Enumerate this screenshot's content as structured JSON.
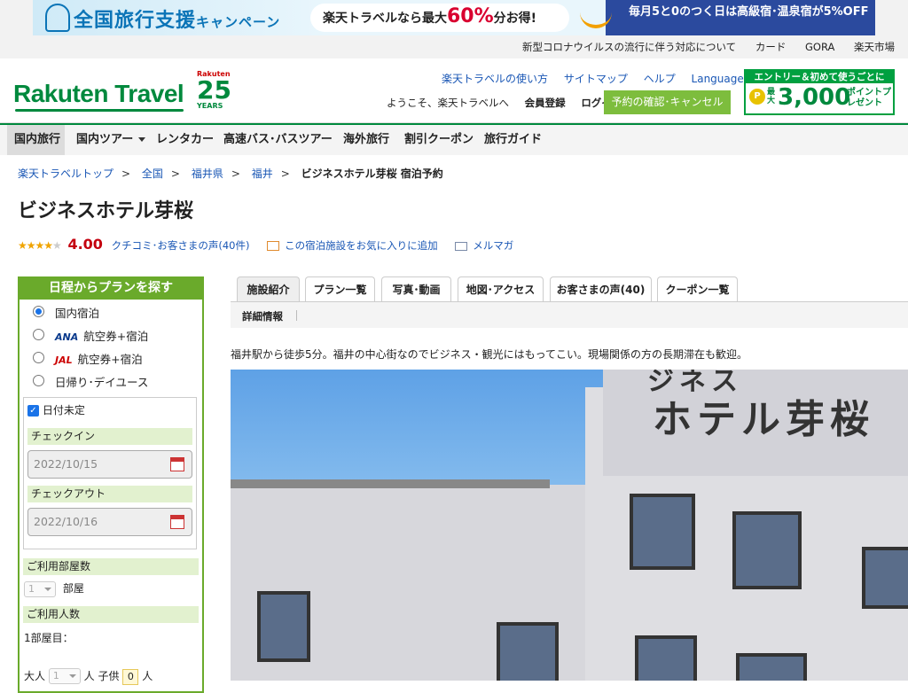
{
  "banner": {
    "title": "全国旅行支援",
    "title_suffix": "キャンペーン",
    "pill_pre": "楽天トラベルなら最大",
    "pill_num": "60%",
    "pill_post": "分お得!",
    "right_line1": "毎月5と0のつく日は高級宿･温泉宿が5%OFF"
  },
  "util_links": [
    "新型コロナウイルスの流行に伴う対応について",
    "カード",
    "GORA",
    "楽天市場"
  ],
  "header": {
    "logo": "Rakuten Travel",
    "years_brand": "Rakuten",
    "years_num": "25",
    "years_label": "YEARS",
    "links": [
      "楽天トラベルの使い方",
      "サイトマップ",
      "ヘルプ"
    ],
    "languages": "Languages",
    "welcome": "ようこそ、楽天トラベルへ",
    "register": "会員登録",
    "login": "ログイン",
    "reserve_button": "予約の確認･キャンセル",
    "promo_title": "エントリー＆初めて使うごとに",
    "promo_small": "最大",
    "promo_amount": "3,000",
    "promo_pt": "ポイントプレゼント"
  },
  "nav": [
    "国内旅行",
    "国内ツアー",
    "レンタカー",
    "高速バス･バスツアー",
    "海外旅行",
    "割引クーポン",
    "旅行ガイド"
  ],
  "breadcrumb": {
    "links": [
      "楽天トラベルトップ",
      "全国",
      "福井県",
      "福井"
    ],
    "current": "ビジネスホテル芽桜 宿泊予約"
  },
  "hotel": {
    "name": "ビジネスホテル芽桜",
    "score": "4.00",
    "stars_on": 4,
    "reviews": "クチコミ･お客さまの声(40件)",
    "favorite": "この宿泊施設をお気に入りに追加",
    "mailmag": "メルマガ",
    "description": "福井駅から徒歩5分。福井の中心街なのでビジネス・観光にはもってこい。現場関係の方の長期滞在も歓迎。",
    "sign_text_top": "ジネス",
    "sign_text_main": "ホテル芽桜"
  },
  "search": {
    "title": "日程からプランを探す",
    "options": [
      "国内宿泊",
      "航空券+宿泊",
      "航空券+宿泊",
      "日帰り･デイユース"
    ],
    "ana": "ANA",
    "jal": "JAL",
    "undecided": "日付未定",
    "checkin_label": "チェックイン",
    "checkin_value": "2022/10/15",
    "checkout_label": "チェックアウト",
    "checkout_value": "2022/10/16",
    "rooms_label": "ご利用部屋数",
    "rooms_value": "1",
    "rooms_unit": "部屋",
    "people_label": "ご利用人数",
    "room1": "1部屋目：",
    "adults_label": "大人",
    "adults_value": "1",
    "adults_unit": "人",
    "child_label": "子供",
    "child_value": "0",
    "child_unit": "人"
  },
  "tabs": [
    "施設紹介",
    "プラン一覧",
    "写真･動画",
    "地図･アクセス",
    "お客さまの声(40)",
    "クーポン一覧"
  ],
  "subtab": "詳細情報",
  "colors": {
    "brand_green": "#00893d",
    "accent_green": "#6aaa2b",
    "price_red": "#c4000e"
  }
}
